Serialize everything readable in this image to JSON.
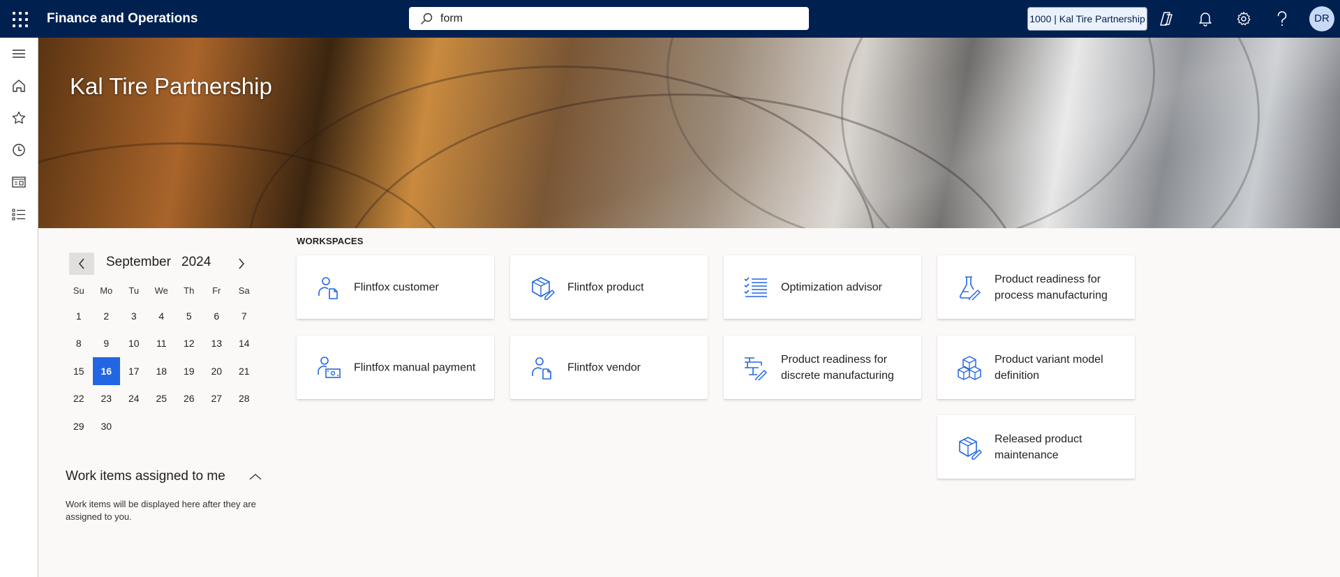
{
  "app": {
    "title": "Finance and Operations"
  },
  "search": {
    "value": "form"
  },
  "company_picker": {
    "label": "1000 | Kal Tire Partnership"
  },
  "user": {
    "initials": "DR"
  },
  "banner": {
    "title": "Kal Tire Partnership"
  },
  "calendar": {
    "month": "September",
    "year": "2024",
    "weekdays": [
      "Su",
      "Mo",
      "Tu",
      "We",
      "Th",
      "Fr",
      "Sa"
    ],
    "weeks": [
      [
        "1",
        "2",
        "3",
        "4",
        "5",
        "6",
        "7"
      ],
      [
        "8",
        "9",
        "10",
        "11",
        "12",
        "13",
        "14"
      ],
      [
        "15",
        "16",
        "17",
        "18",
        "19",
        "20",
        "21"
      ],
      [
        "22",
        "23",
        "24",
        "25",
        "26",
        "27",
        "28"
      ],
      [
        "29",
        "30",
        "",
        "",
        "",
        "",
        ""
      ]
    ],
    "selected_day": "16"
  },
  "work_items": {
    "title": "Work items assigned to me",
    "empty_text": "Work items will be displayed here after they are assigned to you."
  },
  "workspaces": {
    "heading": "WORKSPACES",
    "tiles": [
      {
        "label": "Flintfox customer",
        "icon": "person-document-icon"
      },
      {
        "label": "Flintfox product",
        "icon": "package-edit-icon"
      },
      {
        "label": "Optimization advisor",
        "icon": "checklist-icon"
      },
      {
        "label": "Product readiness for process manufacturing",
        "icon": "beaker-edit-icon"
      },
      {
        "label": "Flintfox manual payment",
        "icon": "person-money-icon"
      },
      {
        "label": "Flintfox vendor",
        "icon": "person-document-icon"
      },
      {
        "label": "Product readiness for discrete manufacturing",
        "icon": "assembly-edit-icon"
      },
      {
        "label": "Product variant model definition",
        "icon": "boxes-icon"
      },
      {
        "label": "Released product maintenance",
        "icon": "package-edit-icon"
      }
    ]
  },
  "colors": {
    "topbar": "#002050",
    "accent": "#2266e3",
    "icon": "#2266e3"
  }
}
